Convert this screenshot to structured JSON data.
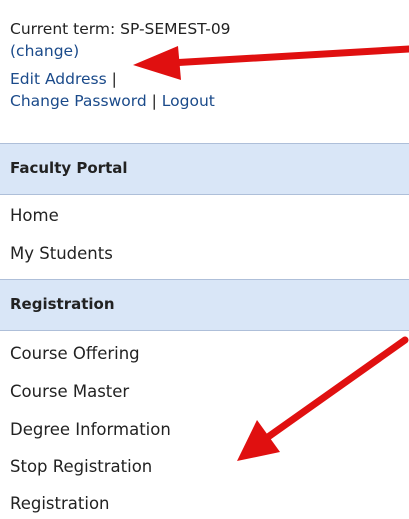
{
  "term": {
    "label": "Current term: SP-SEMEST-09",
    "change_link": "(change)"
  },
  "account_links": {
    "edit_address": "Edit Address",
    "change_password": "Change Password",
    "logout": "Logout",
    "separator": "|"
  },
  "sections": [
    {
      "title": "Faculty Portal",
      "items": [
        "Home",
        "My Students"
      ]
    },
    {
      "title": "Registration",
      "items": [
        "Course Offering",
        "Course Master",
        "Degree Information",
        "Stop Registration",
        "Registration"
      ]
    }
  ],
  "annotations": {
    "arrow_color": "#e01010"
  }
}
